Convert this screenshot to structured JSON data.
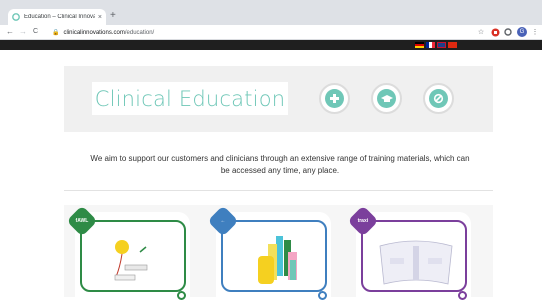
{
  "browser": {
    "tab_title": "Education – Clinical Innovations",
    "tab_close": "×",
    "new_tab": "+",
    "back": "←",
    "forward": "→",
    "reload": "C",
    "url_domain": "clinicalinnovations.com",
    "url_path": "/education/",
    "star": "☆",
    "profile_initial": "G",
    "menu": "⋮"
  },
  "site": {
    "flags": [
      "de",
      "fr",
      "uk",
      "cn"
    ]
  },
  "hero": {
    "title": "Clinical Education",
    "icons": [
      "plus-icon",
      "graduation-cap-icon",
      "swirl-icon"
    ],
    "accent_color": "#6fc7b7"
  },
  "intro_text": "We aim to support our customers and clinicians through an extensive range of training materials, which can be accessed any time, any place.",
  "cards": [
    {
      "badge": "fAWL",
      "color": "#2e8b46"
    },
    {
      "badge": "",
      "color": "#3f7fbf"
    },
    {
      "badge": "traxi",
      "color": "#7b3f9c"
    }
  ]
}
